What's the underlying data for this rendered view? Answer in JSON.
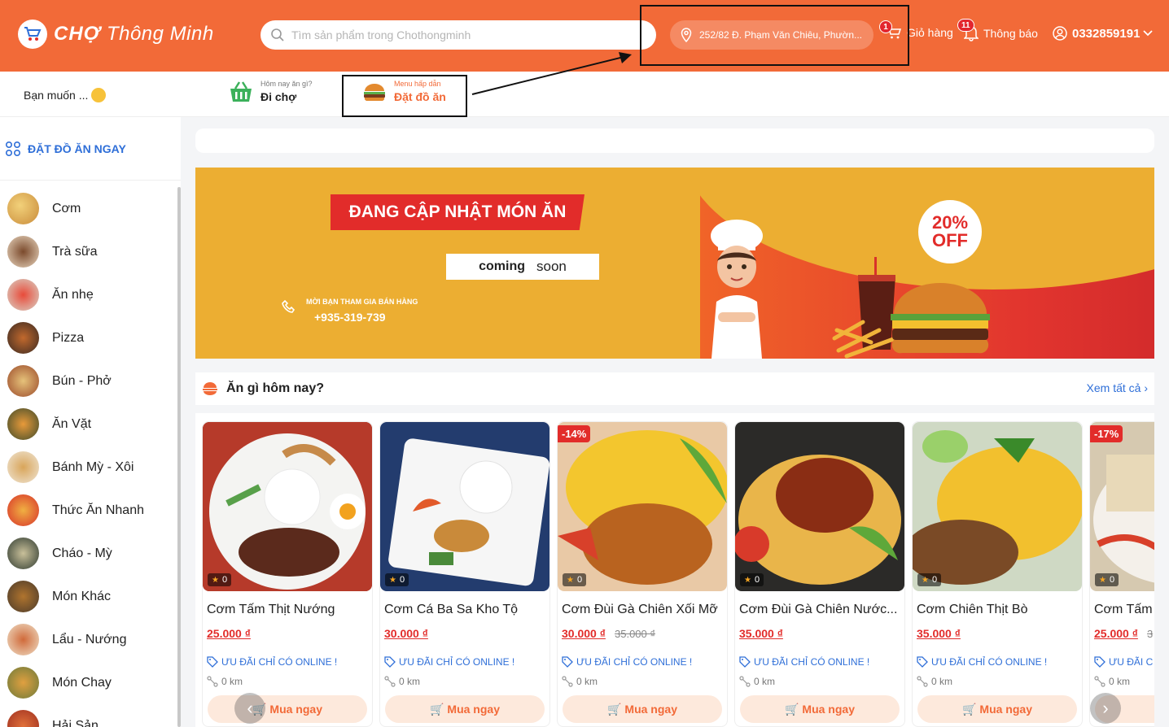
{
  "header": {
    "logo_bold": "CHỢ",
    "logo_rest": "Thông Minh",
    "search_placeholder": "Tìm sản phẩm trong Chothongminh",
    "location": "252/82 Đ. Phạm Văn Chiêu, Phườn...",
    "location_count": "1",
    "cart_label": "Giỏ hàng",
    "notif_count": "11",
    "notif_label": "Thông báo",
    "account": "0332859191"
  },
  "subnav": {
    "want": "Bạn muốn ...",
    "options": [
      {
        "small": "Hôm nay ăn gì?",
        "label": "Đi chợ"
      },
      {
        "small": "Menu hấp dẫn",
        "label": "Đặt đồ ăn"
      }
    ]
  },
  "sidebar": {
    "title": "ĐẶT ĐỒ ĂN NGAY",
    "items": [
      "Cơm",
      "Trà sữa",
      "Ăn nhẹ",
      "Pizza",
      "Bún - Phở",
      "Ăn Vặt",
      "Bánh Mỳ - Xôi",
      "Thức Ăn Nhanh",
      "Cháo - Mỳ",
      "Món Khác",
      "Lẩu - Nướng",
      "Món Chay",
      "Hải Sản"
    ]
  },
  "banner": {
    "title": "ĐANG CẬP NHẬT MÓN ĂN",
    "coming": "coming",
    "soon": "soon",
    "contact": "MỜI BẠN THAM GIA BÁN HÀNG",
    "phone": "+935-319-739",
    "off_pct": "20%",
    "off_word": "OFF"
  },
  "section": {
    "title": "Ăn gì hôm nay?",
    "see_all": "Xem tất cả"
  },
  "products": [
    {
      "name": "Cơm Tấm Thịt Nướng",
      "price": "25.000 ₫",
      "old": "",
      "discount": "",
      "rating": "0",
      "promo": "ƯU ĐÃI CHỈ CÓ ONLINE !",
      "distance": "0 km",
      "buy": "Mua ngay"
    },
    {
      "name": "Cơm Cá Ba Sa Kho Tộ",
      "price": "30.000 ₫",
      "old": "",
      "discount": "",
      "rating": "0",
      "promo": "ƯU ĐÃI CHỈ CÓ ONLINE !",
      "distance": "0 km",
      "buy": "Mua ngay"
    },
    {
      "name": "Cơm Đùi Gà Chiên Xối Mỡ",
      "price": "30.000 ₫",
      "old": "35.000 ₫",
      "discount": "-14%",
      "rating": "0",
      "promo": "ƯU ĐÃI CHỈ CÓ ONLINE !",
      "distance": "0 km",
      "buy": "Mua ngay"
    },
    {
      "name": "Cơm Đùi Gà Chiên Nước...",
      "price": "35.000 ₫",
      "old": "",
      "discount": "",
      "rating": "0",
      "promo": "ƯU ĐÃI CHỈ CÓ ONLINE !",
      "distance": "0 km",
      "buy": "Mua ngay"
    },
    {
      "name": "Cơm Chiên Thịt Bò",
      "price": "35.000 ₫",
      "old": "",
      "discount": "",
      "rating": "0",
      "promo": "ƯU ĐÃI CHỈ CÓ ONLINE !",
      "distance": "0 km",
      "buy": "Mua ngay"
    },
    {
      "name": "Cơm Tấm",
      "price": "25.000 ₫",
      "old": "3",
      "discount": "-17%",
      "rating": "0",
      "promo": "ƯU ĐÃI C",
      "distance": "0 km",
      "buy": ""
    }
  ],
  "colors": {
    "brand": "#f26a38",
    "link": "#2f6fd8",
    "price": "#e22c2a"
  }
}
